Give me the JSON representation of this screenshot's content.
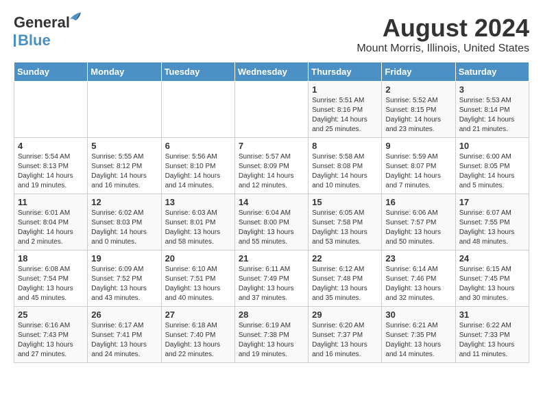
{
  "header": {
    "logo_line1": "General",
    "logo_line2": "Blue",
    "main_title": "August 2024",
    "subtitle": "Mount Morris, Illinois, United States"
  },
  "days_of_week": [
    "Sunday",
    "Monday",
    "Tuesday",
    "Wednesday",
    "Thursday",
    "Friday",
    "Saturday"
  ],
  "weeks": [
    [
      {
        "day": "",
        "info": ""
      },
      {
        "day": "",
        "info": ""
      },
      {
        "day": "",
        "info": ""
      },
      {
        "day": "",
        "info": ""
      },
      {
        "day": "1",
        "info": "Sunrise: 5:51 AM\nSunset: 8:16 PM\nDaylight: 14 hours\nand 25 minutes."
      },
      {
        "day": "2",
        "info": "Sunrise: 5:52 AM\nSunset: 8:15 PM\nDaylight: 14 hours\nand 23 minutes."
      },
      {
        "day": "3",
        "info": "Sunrise: 5:53 AM\nSunset: 8:14 PM\nDaylight: 14 hours\nand 21 minutes."
      }
    ],
    [
      {
        "day": "4",
        "info": "Sunrise: 5:54 AM\nSunset: 8:13 PM\nDaylight: 14 hours\nand 19 minutes."
      },
      {
        "day": "5",
        "info": "Sunrise: 5:55 AM\nSunset: 8:12 PM\nDaylight: 14 hours\nand 16 minutes."
      },
      {
        "day": "6",
        "info": "Sunrise: 5:56 AM\nSunset: 8:10 PM\nDaylight: 14 hours\nand 14 minutes."
      },
      {
        "day": "7",
        "info": "Sunrise: 5:57 AM\nSunset: 8:09 PM\nDaylight: 14 hours\nand 12 minutes."
      },
      {
        "day": "8",
        "info": "Sunrise: 5:58 AM\nSunset: 8:08 PM\nDaylight: 14 hours\nand 10 minutes."
      },
      {
        "day": "9",
        "info": "Sunrise: 5:59 AM\nSunset: 8:07 PM\nDaylight: 14 hours\nand 7 minutes."
      },
      {
        "day": "10",
        "info": "Sunrise: 6:00 AM\nSunset: 8:05 PM\nDaylight: 14 hours\nand 5 minutes."
      }
    ],
    [
      {
        "day": "11",
        "info": "Sunrise: 6:01 AM\nSunset: 8:04 PM\nDaylight: 14 hours\nand 2 minutes."
      },
      {
        "day": "12",
        "info": "Sunrise: 6:02 AM\nSunset: 8:03 PM\nDaylight: 14 hours\nand 0 minutes."
      },
      {
        "day": "13",
        "info": "Sunrise: 6:03 AM\nSunset: 8:01 PM\nDaylight: 13 hours\nand 58 minutes."
      },
      {
        "day": "14",
        "info": "Sunrise: 6:04 AM\nSunset: 8:00 PM\nDaylight: 13 hours\nand 55 minutes."
      },
      {
        "day": "15",
        "info": "Sunrise: 6:05 AM\nSunset: 7:58 PM\nDaylight: 13 hours\nand 53 minutes."
      },
      {
        "day": "16",
        "info": "Sunrise: 6:06 AM\nSunset: 7:57 PM\nDaylight: 13 hours\nand 50 minutes."
      },
      {
        "day": "17",
        "info": "Sunrise: 6:07 AM\nSunset: 7:55 PM\nDaylight: 13 hours\nand 48 minutes."
      }
    ],
    [
      {
        "day": "18",
        "info": "Sunrise: 6:08 AM\nSunset: 7:54 PM\nDaylight: 13 hours\nand 45 minutes."
      },
      {
        "day": "19",
        "info": "Sunrise: 6:09 AM\nSunset: 7:52 PM\nDaylight: 13 hours\nand 43 minutes."
      },
      {
        "day": "20",
        "info": "Sunrise: 6:10 AM\nSunset: 7:51 PM\nDaylight: 13 hours\nand 40 minutes."
      },
      {
        "day": "21",
        "info": "Sunrise: 6:11 AM\nSunset: 7:49 PM\nDaylight: 13 hours\nand 37 minutes."
      },
      {
        "day": "22",
        "info": "Sunrise: 6:12 AM\nSunset: 7:48 PM\nDaylight: 13 hours\nand 35 minutes."
      },
      {
        "day": "23",
        "info": "Sunrise: 6:14 AM\nSunset: 7:46 PM\nDaylight: 13 hours\nand 32 minutes."
      },
      {
        "day": "24",
        "info": "Sunrise: 6:15 AM\nSunset: 7:45 PM\nDaylight: 13 hours\nand 30 minutes."
      }
    ],
    [
      {
        "day": "25",
        "info": "Sunrise: 6:16 AM\nSunset: 7:43 PM\nDaylight: 13 hours\nand 27 minutes."
      },
      {
        "day": "26",
        "info": "Sunrise: 6:17 AM\nSunset: 7:41 PM\nDaylight: 13 hours\nand 24 minutes."
      },
      {
        "day": "27",
        "info": "Sunrise: 6:18 AM\nSunset: 7:40 PM\nDaylight: 13 hours\nand 22 minutes."
      },
      {
        "day": "28",
        "info": "Sunrise: 6:19 AM\nSunset: 7:38 PM\nDaylight: 13 hours\nand 19 minutes."
      },
      {
        "day": "29",
        "info": "Sunrise: 6:20 AM\nSunset: 7:37 PM\nDaylight: 13 hours\nand 16 minutes."
      },
      {
        "day": "30",
        "info": "Sunrise: 6:21 AM\nSunset: 7:35 PM\nDaylight: 13 hours\nand 14 minutes."
      },
      {
        "day": "31",
        "info": "Sunrise: 6:22 AM\nSunset: 7:33 PM\nDaylight: 13 hours\nand 11 minutes."
      }
    ]
  ]
}
